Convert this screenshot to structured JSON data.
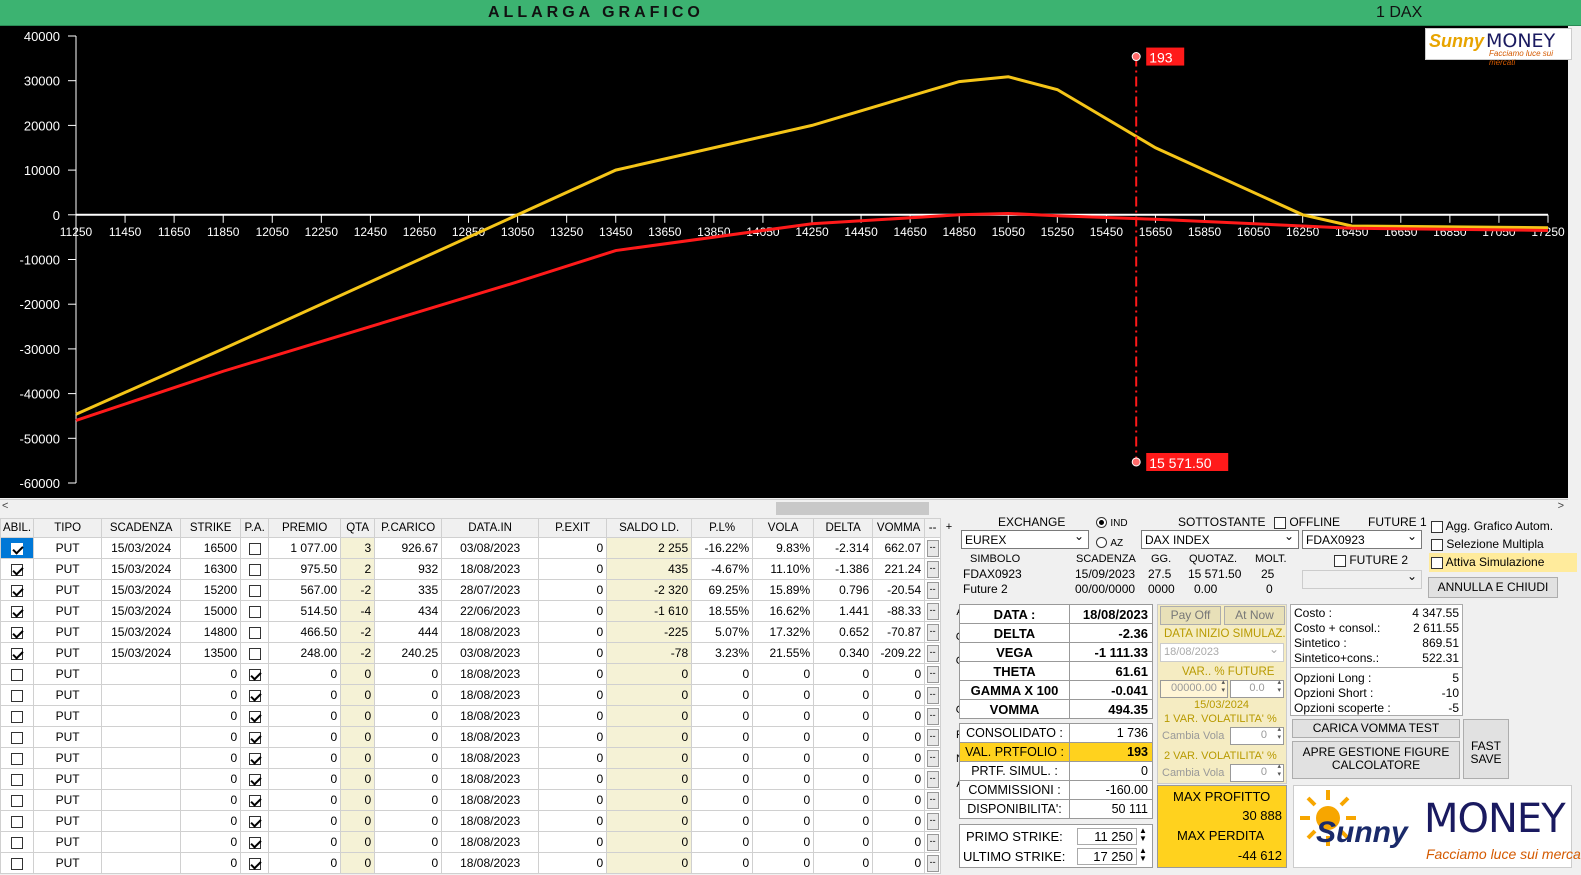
{
  "header": {
    "title": "ALLARGA GRAFICO",
    "instrument": "1 DAX"
  },
  "logo": {
    "brand1": "Sunny",
    "brand2": "MONEY",
    "tagline": "Facciamo luce sui mercati"
  },
  "chart_data": {
    "type": "line",
    "x_ticks": [
      11250,
      11450,
      11650,
      11850,
      12050,
      12250,
      12450,
      12650,
      12850,
      13050,
      13250,
      13450,
      13650,
      13850,
      14050,
      14250,
      14450,
      14650,
      14850,
      15050,
      15250,
      15450,
      15650,
      15850,
      16050,
      16250,
      16450,
      16650,
      16850,
      17050,
      17250
    ],
    "y_ticks": [
      40000,
      30000,
      20000,
      10000,
      0,
      -10000,
      -20000,
      -30000,
      -40000,
      -50000,
      -60000
    ],
    "ylim": [
      -60000,
      40000
    ],
    "xlim": [
      11250,
      17250
    ],
    "series": [
      {
        "color": "#f5c518",
        "x": [
          11250,
          11850,
          12450,
          13050,
          13450,
          14250,
          14850,
          15050,
          15250,
          15650,
          16250,
          16450,
          17250
        ],
        "y": [
          -44612,
          -30000,
          -15000,
          0,
          10000,
          20000,
          29800,
          30888,
          28000,
          15000,
          0,
          -2500,
          -2900
        ]
      },
      {
        "color": "#ff1a1a",
        "x": [
          11250,
          11850,
          12450,
          13050,
          13450,
          14250,
          14850,
          15050,
          15250,
          15650,
          16250,
          16450,
          17250
        ],
        "y": [
          -46000,
          -35000,
          -25000,
          -15000,
          -8000,
          -2000,
          0,
          300,
          -200,
          -1000,
          -2500,
          -3000,
          -3500
        ]
      }
    ],
    "marker": {
      "x": 15571.5,
      "top_label": "193",
      "bottom_label": "15 571.50"
    },
    "grid": false
  },
  "table": {
    "headers": [
      "ABIL.",
      "TIPO",
      "SCADENZA",
      "STRIKE",
      "P.A.",
      "PREMIO",
      "QTA",
      "P.CARICO",
      "DATA.IN",
      "P.EXIT",
      "SALDO LD.",
      "P.L%",
      "VOLA",
      "DELTA",
      "VOMMA",
      "--",
      "+"
    ],
    "rows": [
      {
        "abil": true,
        "sel": true,
        "tipo": "PUT",
        "scad": "15/03/2024",
        "strike": "16500",
        "pa": false,
        "premio": "1 077.00",
        "qta": "3",
        "pcar": "926.67",
        "datain": "03/08/2023",
        "pexit": "0",
        "saldo": "2 255",
        "pl": "-16.22%",
        "vola": "9.83%",
        "delta": "-2.314",
        "vomma": "662.07"
      },
      {
        "abil": true,
        "tipo": "PUT",
        "scad": "15/03/2024",
        "strike": "16300",
        "pa": false,
        "premio": "975.50",
        "qta": "2",
        "pcar": "932",
        "datain": "18/08/2023",
        "pexit": "0",
        "saldo": "435",
        "pl": "-4.67%",
        "vola": "11.10%",
        "delta": "-1.386",
        "vomma": "221.24"
      },
      {
        "abil": true,
        "tipo": "PUT",
        "scad": "15/03/2024",
        "strike": "15200",
        "pa": false,
        "premio": "567.00",
        "qta": "-2",
        "pcar": "335",
        "datain": "28/07/2023",
        "pexit": "0",
        "saldo": "-2 320",
        "pl": "69.25%",
        "vola": "15.89%",
        "delta": "0.796",
        "vomma": "-20.54"
      },
      {
        "abil": true,
        "tipo": "PUT",
        "scad": "15/03/2024",
        "strike": "15000",
        "pa": false,
        "premio": "514.50",
        "qta": "-4",
        "pcar": "434",
        "datain": "22/06/2023",
        "pexit": "0",
        "saldo": "-1 610",
        "pl": "18.55%",
        "vola": "16.62%",
        "delta": "1.441",
        "vomma": "-88.33"
      },
      {
        "abil": true,
        "tipo": "PUT",
        "scad": "15/03/2024",
        "strike": "14800",
        "pa": false,
        "premio": "466.50",
        "qta": "-2",
        "pcar": "444",
        "datain": "18/08/2023",
        "pexit": "0",
        "saldo": "-225",
        "pl": "5.07%",
        "vola": "17.32%",
        "delta": "0.652",
        "vomma": "-70.87"
      },
      {
        "abil": true,
        "tipo": "PUT",
        "scad": "15/03/2024",
        "strike": "13500",
        "pa": false,
        "premio": "248.00",
        "qta": "-2",
        "pcar": "240.25",
        "datain": "03/08/2023",
        "pexit": "0",
        "saldo": "-78",
        "pl": "3.23%",
        "vola": "21.55%",
        "delta": "0.340",
        "vomma": "-209.22"
      },
      {
        "abil": false,
        "tipo": "PUT",
        "scad": "",
        "strike": "0",
        "pa": true,
        "premio": "0",
        "qta": "0",
        "pcar": "0",
        "datain": "18/08/2023",
        "pexit": "0",
        "saldo": "0",
        "pl": "0",
        "vola": "0",
        "delta": "0",
        "vomma": "0"
      },
      {
        "abil": false,
        "tipo": "PUT",
        "scad": "",
        "strike": "0",
        "pa": true,
        "premio": "0",
        "qta": "0",
        "pcar": "0",
        "datain": "18/08/2023",
        "pexit": "0",
        "saldo": "0",
        "pl": "0",
        "vola": "0",
        "delta": "0",
        "vomma": "0"
      },
      {
        "abil": false,
        "tipo": "PUT",
        "scad": "",
        "strike": "0",
        "pa": true,
        "premio": "0",
        "qta": "0",
        "pcar": "0",
        "datain": "18/08/2023",
        "pexit": "0",
        "saldo": "0",
        "pl": "0",
        "vola": "0",
        "delta": "0",
        "vomma": "0"
      },
      {
        "abil": false,
        "tipo": "PUT",
        "scad": "",
        "strike": "0",
        "pa": true,
        "premio": "0",
        "qta": "0",
        "pcar": "0",
        "datain": "18/08/2023",
        "pexit": "0",
        "saldo": "0",
        "pl": "0",
        "vola": "0",
        "delta": "0",
        "vomma": "0"
      },
      {
        "abil": false,
        "tipo": "PUT",
        "scad": "",
        "strike": "0",
        "pa": true,
        "premio": "0",
        "qta": "0",
        "pcar": "0",
        "datain": "18/08/2023",
        "pexit": "0",
        "saldo": "0",
        "pl": "0",
        "vola": "0",
        "delta": "0",
        "vomma": "0"
      },
      {
        "abil": false,
        "tipo": "PUT",
        "scad": "",
        "strike": "0",
        "pa": true,
        "premio": "0",
        "qta": "0",
        "pcar": "0",
        "datain": "18/08/2023",
        "pexit": "0",
        "saldo": "0",
        "pl": "0",
        "vola": "0",
        "delta": "0",
        "vomma": "0"
      },
      {
        "abil": false,
        "tipo": "PUT",
        "scad": "",
        "strike": "0",
        "pa": true,
        "premio": "0",
        "qta": "0",
        "pcar": "0",
        "datain": "18/08/2023",
        "pexit": "0",
        "saldo": "0",
        "pl": "0",
        "vola": "0",
        "delta": "0",
        "vomma": "0"
      },
      {
        "abil": false,
        "tipo": "PUT",
        "scad": "",
        "strike": "0",
        "pa": true,
        "premio": "0",
        "qta": "0",
        "pcar": "0",
        "datain": "18/08/2023",
        "pexit": "0",
        "saldo": "0",
        "pl": "0",
        "vola": "0",
        "delta": "0",
        "vomma": "0"
      },
      {
        "abil": false,
        "tipo": "PUT",
        "scad": "",
        "strike": "0",
        "pa": true,
        "premio": "0",
        "qta": "0",
        "pcar": "0",
        "datain": "18/08/2023",
        "pexit": "0",
        "saldo": "0",
        "pl": "0",
        "vola": "0",
        "delta": "0",
        "vomma": "0"
      },
      {
        "abil": false,
        "tipo": "PUT",
        "scad": "",
        "strike": "0",
        "pa": true,
        "premio": "0",
        "qta": "0",
        "pcar": "0",
        "datain": "18/08/2023",
        "pexit": "0",
        "saldo": "0",
        "pl": "0",
        "vola": "0",
        "delta": "0",
        "vomma": "0"
      }
    ],
    "aggiorna": [
      "A",
      "G",
      "G",
      "I",
      "O",
      "R",
      "N",
      "A"
    ]
  },
  "market": {
    "exchange_label": "EXCHANGE",
    "exchange_value": "EUREX",
    "ind_label": "IND",
    "az_label": "AZ",
    "sottostante_label": "SOTTOSTANTE",
    "sottostante_value": "DAX INDEX",
    "offline_label": "OFFLINE",
    "future1_label": "FUTURE 1",
    "future1_value": "FDAX0923",
    "future2_label": "FUTURE 2",
    "col_simbolo": "SIMBOLO",
    "col_scadenza": "SCADENZA",
    "col_gg": "GG.",
    "col_quotaz": "QUOTAZ.",
    "col_molt": "MOLT.",
    "r1": {
      "simbolo": "FDAX0923",
      "scadenza": "15/09/2023",
      "gg": "27.5",
      "quotaz": "15 571.50",
      "molt": "25"
    },
    "r2": {
      "simbolo": "Future 2",
      "scadenza": "00/00/0000",
      "gg": "0000",
      "quotaz": "0.00",
      "molt": "0"
    }
  },
  "options": {
    "agg_grafico": "Agg. Grafico Autom.",
    "selezione": "Selezione Multipla",
    "simulazione": "Attiva Simulazione",
    "annulla": "ANNULLA E CHIUDI"
  },
  "greeks": {
    "data_label": "DATA :",
    "data_value": "18/08/2023",
    "delta_label": "DELTA",
    "delta_value": "-2.36",
    "vega_label": "VEGA",
    "vega_value": "-1 111.33",
    "theta_label": "THETA",
    "theta_value": "61.61",
    "gamma_label": "GAMMA X 100",
    "gamma_value": "-0.041",
    "vomma_label": "VOMMA",
    "vomma_value": "494.35"
  },
  "portfolio": {
    "consolidato_label": "CONSOLIDATO :",
    "consolidato_value": "1 736",
    "valprt_label": "VAL. PRTFOLIO :",
    "valprt_value": "193",
    "simul_label": "PRTF. SIMUL. :",
    "simul_value": "0",
    "comm_label": "COMMISSIONI :",
    "comm_value": "-160.00",
    "disp_label": "DISPONIBILITA':",
    "disp_value": "50 111"
  },
  "strikes": {
    "primo_label": "PRIMO STRIKE:",
    "primo_value": "11 250",
    "ultimo_label": "ULTIMO STRIKE:",
    "ultimo_value": "17 250"
  },
  "sim": {
    "payoff": "Pay Off",
    "atnow": "At Now",
    "data_inizio": "DATA INIZIO SIMULAZ.",
    "data_inizio_value": "18/08/2023",
    "var_future": "VAR.. % FUTURE",
    "var_future_v1": "00000.00",
    "var_future_v2": "0.0",
    "date2": "15/03/2024",
    "var_vola1": "1 VAR. VOLATILITA' %",
    "cambia1": "Cambia Vola",
    "cambia1_v": "0",
    "var_vola2": "2 VAR. VOLATILITA' %",
    "cambia2": "Cambia Vola",
    "cambia2_v": "0"
  },
  "limits": {
    "max_profit_label": "MAX PROFITTO",
    "max_profit_value": "30 888",
    "max_loss_label": "MAX PERDITA",
    "max_loss_value": "-44 612"
  },
  "costs": {
    "costo_label": "Costo :",
    "costo_value": "4 347.55",
    "consol_label": "Costo + consol.:",
    "consol_value": "2 611.55",
    "sint_label": "Sintetico :",
    "sint_value": "869.51",
    "sintc_label": "Sintetico+cons.:",
    "sintc_value": "522.31",
    "long_label": "Opzioni Long :",
    "long_value": "5",
    "short_label": "Opzioni Short :",
    "short_value": "-10",
    "scop_label": "Opzioni scoperte :",
    "scop_value": "-5"
  },
  "buttons": {
    "carica": "CARICA VOMMA TEST",
    "apre": "APRE GESTIONE FIGURE CALCOLATORE",
    "fast": "FAST SAVE"
  },
  "colors": {
    "green": "#3cb371",
    "yellow": "#ffd21e",
    "payoff_today": "#f5c518",
    "payoff_exp": "#ff1a1a",
    "marker": "#ff1a1a"
  }
}
